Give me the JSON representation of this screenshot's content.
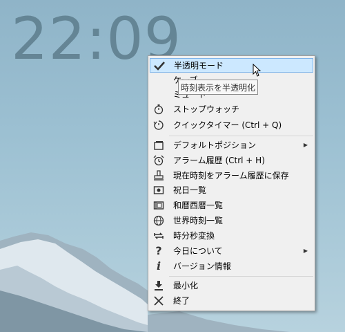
{
  "clock": {
    "time": "22:09"
  },
  "tooltip": {
    "text": "時刻表示を半透明化"
  },
  "menu": {
    "items": [
      {
        "label": "半透明モード",
        "icon": "checkmark-icon"
      },
      {
        "label": "ケーブ",
        "icon": ""
      },
      {
        "label": "ミュート",
        "icon": ""
      },
      {
        "label": "ストップウォッチ",
        "icon": "stopwatch-icon"
      },
      {
        "label": "クイックタイマー (Ctrl + Q)",
        "icon": "timer-icon"
      },
      {
        "label": "デフォルトポジション",
        "icon": "window-icon"
      },
      {
        "label": "アラーム履歴 (Ctrl + H)",
        "icon": "alarm-clock-icon"
      },
      {
        "label": "現在時刻をアラーム履歴に保存",
        "icon": "stamp-icon"
      },
      {
        "label": "祝日一覧",
        "icon": "holiday-icon"
      },
      {
        "label": "和暦西暦一覧",
        "icon": "calendar-icon"
      },
      {
        "label": "世界時刻一覧",
        "icon": "globe-icon"
      },
      {
        "label": "時分秒変換",
        "icon": "convert-icon"
      },
      {
        "label": "今日について",
        "icon": "question-icon"
      },
      {
        "label": "バージョン情報",
        "icon": "info-icon"
      },
      {
        "label": "最小化",
        "icon": "download-icon"
      },
      {
        "label": "終了",
        "icon": "close-icon"
      }
    ]
  }
}
